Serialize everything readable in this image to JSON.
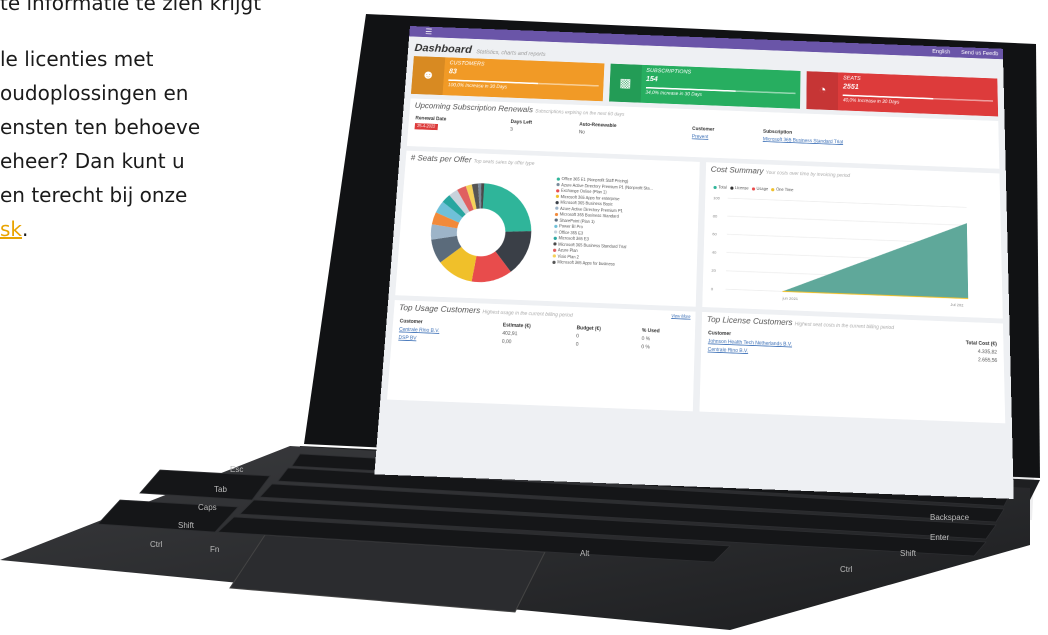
{
  "copy": {
    "line0": "te informatie te zien krijgt",
    "line1": "le licenties met",
    "line2": "oudoplossingen en",
    "line3": "ensten ten behoeve",
    "line4": "eheer? Dan kunt u",
    "line5": "en terecht bij onze",
    "link": "sk",
    "tail": "."
  },
  "app": {
    "topbar": {
      "menu_icon": "hamburger-icon",
      "lang": "English",
      "feedback": "Send us Feedb"
    },
    "title": "Dashboard",
    "subtitle": "Statistics, charts and reports",
    "kpis": [
      {
        "label": "CUSTOMERS",
        "value": "83",
        "note": "100,0% Increase in 30 Days",
        "icon": "users-icon",
        "color": "#f19a26"
      },
      {
        "label": "SUBSCRIPTIONS",
        "value": "154",
        "note": "34,0% Increase in 30 Days",
        "icon": "bar-chart-icon",
        "color": "#27ae60"
      },
      {
        "label": "SEATS",
        "value": "2551",
        "note": "40,0% Increase in 30 Days",
        "icon": "pie-chart-icon",
        "color": "#dd3b3b"
      }
    ],
    "renewals": {
      "title": "Upcoming Subscription Renewals",
      "subtitle": "Subscriptions expiring on the next 60 days",
      "headers": [
        "Renewal Date",
        "Days Left",
        "Auto-Renewable",
        "Customer",
        "Subscription"
      ],
      "row": [
        "25-4-2022",
        "3",
        "No",
        "Prevent",
        "Microsoft 365 Business Standard Trial"
      ]
    },
    "seats": {
      "title": "# Seats per Offer",
      "subtitle": "Top seats sales by offer type",
      "legend": [
        {
          "label": "Office 365 E1 (Nonprofit Staff Pricing)",
          "color": "#2fb59a"
        },
        {
          "label": "Azure Active Directory Premium P1 (Nonprofit Sta...",
          "color": "#7a8a9a"
        },
        {
          "label": "Exchange Online (Plan 1)",
          "color": "#e84c4c"
        },
        {
          "label": "Microsoft 365 Apps for enterprise",
          "color": "#f0c02a"
        },
        {
          "label": "Microsoft 365 Business Basic",
          "color": "#3a3f47"
        },
        {
          "label": "Azure Active Directory Premium P1",
          "color": "#9db4c8"
        },
        {
          "label": "Microsoft 365 Business Standard",
          "color": "#f28a3a"
        },
        {
          "label": "SharePoint (Plan 1)",
          "color": "#5b6b7b"
        },
        {
          "label": "Power BI Pro",
          "color": "#6fc0d8"
        },
        {
          "label": "Office 365 E3",
          "color": "#c8d2dc"
        },
        {
          "label": "Microsoft 365 E3",
          "color": "#28a6a0"
        },
        {
          "label": "Microsoft 365 Business Standard Trial",
          "color": "#4a4a4a"
        },
        {
          "label": "Azure Plan",
          "color": "#e06060"
        },
        {
          "label": "Visio Plan 2",
          "color": "#f5d25a"
        },
        {
          "label": "Microsoft 365 Apps for business",
          "color": "#555555"
        }
      ]
    },
    "cost": {
      "title": "Cost Summary",
      "subtitle": "Your costs over time by invoicing period",
      "legend": [
        {
          "label": "Total",
          "color": "#2fb59a"
        },
        {
          "label": "License",
          "color": "#333333"
        },
        {
          "label": "Usage",
          "color": "#e84c4c"
        },
        {
          "label": "One Time",
          "color": "#f0c02a"
        }
      ],
      "yticks": [
        "100",
        "80",
        "60",
        "40",
        "20",
        "0"
      ],
      "xticks": [
        "jun 2021",
        "Jul 202"
      ]
    },
    "usage": {
      "title": "Top Usage Customers",
      "subtitle": "Highest usage in the current billing period",
      "view_more": "View More",
      "headers": [
        "Customer",
        "Estimate (€)",
        "Budget (€)",
        "% Used"
      ],
      "rows": [
        [
          "Centrale Rino B.V.",
          "402,91",
          "0",
          "0 %"
        ],
        [
          "DSP BV",
          "0,00",
          "0",
          "0 %"
        ]
      ]
    },
    "license": {
      "title": "Top License Customers",
      "subtitle": "Highest seat costs in the current billing period",
      "headers": [
        "Customer",
        "Total Cost (€)"
      ],
      "rows": [
        [
          "Johnson Health Tech Netherlands B.V.",
          "4.335,82"
        ],
        [
          "Centrale Rino B.V.",
          "2.655,56"
        ]
      ]
    }
  },
  "keyboard": {
    "keys": [
      "Esc",
      "Tab",
      "Caps",
      "Shift",
      "Ctrl",
      "Fn",
      "Alt",
      "Backspace",
      "Enter",
      "Shift",
      "Ctrl"
    ]
  }
}
